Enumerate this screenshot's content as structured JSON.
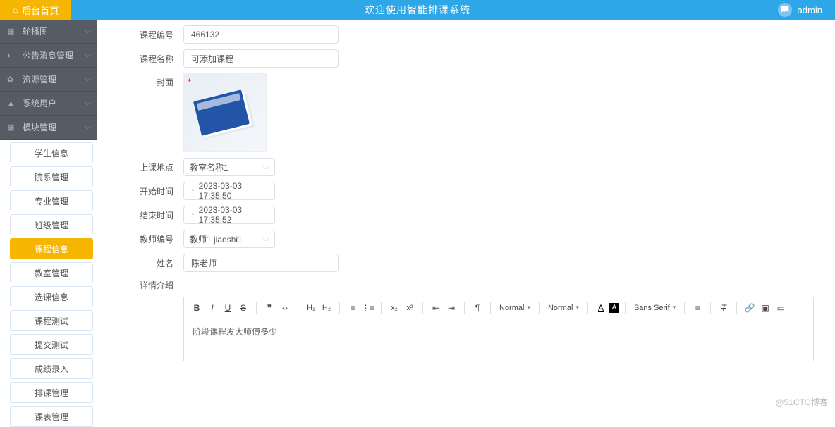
{
  "header": {
    "home": "后台首页",
    "title": "欢迎使用智能排课系统",
    "username": "admin"
  },
  "sidebar": {
    "cats": [
      {
        "icon": "▦",
        "label": "轮播图"
      },
      {
        "icon": "◐",
        "label": "公告消息管理"
      },
      {
        "icon": "✿",
        "label": "资源管理"
      },
      {
        "icon": "▲",
        "label": "系统用户"
      },
      {
        "icon": "▦",
        "label": "模块管理"
      }
    ],
    "subs": [
      {
        "label": "学生信息"
      },
      {
        "label": "院系管理"
      },
      {
        "label": "专业管理"
      },
      {
        "label": "班级管理"
      },
      {
        "label": "课程信息",
        "active": true
      },
      {
        "label": "教室管理"
      },
      {
        "label": "选课信息"
      },
      {
        "label": "课程测试"
      },
      {
        "label": "提交测试"
      },
      {
        "label": "成绩录入"
      },
      {
        "label": "排课管理"
      },
      {
        "label": "课表管理"
      }
    ]
  },
  "form": {
    "course_id_label": "课程编号",
    "course_id_value": "466132",
    "course_name_label": "课程名称",
    "course_name_value": "可添加课程",
    "cover_label": "封面",
    "location_label": "上课地点",
    "location_value": "教室名称1",
    "start_label": "开始时间",
    "start_value": "2023-03-03 17:35:50",
    "end_label": "结束时间",
    "end_value": "2023-03-03 17:35:52",
    "teacher_id_label": "教师编号",
    "teacher_id_value": "教师1 jiaoshi1",
    "name_label": "姓名",
    "name_value": "陈老师",
    "detail_label": "详情介绍",
    "detail_value": "阶段课程发大师傅多少"
  },
  "editor_toolbar": {
    "font": "Normal",
    "size": "Normal",
    "family": "Sans Serif"
  },
  "watermark": "@51CTO博客"
}
